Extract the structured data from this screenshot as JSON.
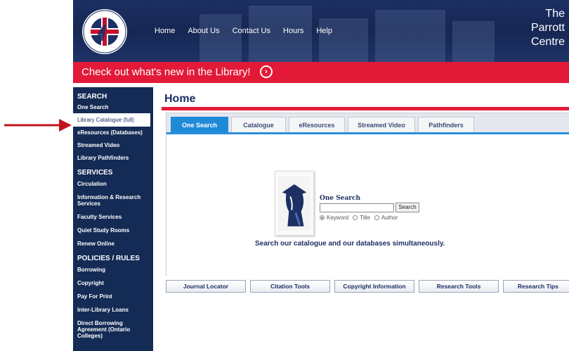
{
  "header": {
    "nav": [
      "Home",
      "About Us",
      "Contact Us",
      "Hours",
      "Help"
    ],
    "brand_lines": [
      "The",
      "Parrott",
      "Centre"
    ]
  },
  "banner": {
    "text": "Check out what's new in the Library!",
    "icon": "chevron-right-circle-icon"
  },
  "sidebar": {
    "sections": [
      {
        "heading": "SEARCH",
        "items": [
          "One Search",
          "Library Catalogue (full)",
          "eResources (Databases)",
          "Streamed Video",
          "Library Pathfinders"
        ]
      },
      {
        "heading": "SERVICES",
        "items": [
          "Circulation",
          "Information & Research Services",
          "Faculty Services",
          "Quiet Study Rooms",
          "Renew Online"
        ]
      },
      {
        "heading": "POLICIES / RULES",
        "items": [
          "Borrowing",
          "Copyright",
          "Pay For Print",
          "Inter-Library Loans",
          "Direct Borrowing Agreement (Ontario Colleges)"
        ]
      }
    ],
    "active_item": "Library Catalogue (full)"
  },
  "main": {
    "title": "Home",
    "tabs": [
      "One Search",
      "Catalogue",
      "eResources",
      "Streamed Video",
      "Pathfinders"
    ],
    "active_tab": "One Search",
    "search": {
      "label": "One Search",
      "button": "Search",
      "value": "",
      "options": [
        "Keyword",
        "Title",
        "Author"
      ],
      "selected": "Keyword"
    },
    "tagline": "Search our catalogue and our databases simultaneously.",
    "quick_links": [
      "Journal Locator",
      "Citation Tools",
      "Copyright Information",
      "Research Tools",
      "Research Tips"
    ]
  },
  "colors": {
    "navy": "#1d2f63",
    "red": "#e21a38",
    "tab_blue": "#1f8ad8"
  }
}
